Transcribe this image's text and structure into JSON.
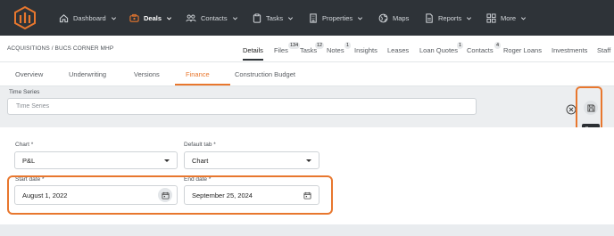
{
  "nav": {
    "items": [
      {
        "label": "Dashboard",
        "icon": "home-icon"
      },
      {
        "label": "Deals",
        "icon": "deals-icon",
        "active": true
      },
      {
        "label": "Contacts",
        "icon": "contacts-icon"
      },
      {
        "label": "Tasks",
        "icon": "clipboard-icon"
      },
      {
        "label": "Properties",
        "icon": "building-icon"
      },
      {
        "label": "Maps",
        "icon": "globe-icon"
      },
      {
        "label": "Reports",
        "icon": "document-icon"
      },
      {
        "label": "More",
        "icon": "grid-icon"
      }
    ]
  },
  "breadcrumb": "ACQUISITIONS / BUCS CORNER MHP",
  "record_tabs": [
    {
      "label": "Details",
      "active": true,
      "badge": ""
    },
    {
      "label": "Files",
      "badge": "134"
    },
    {
      "label": "Tasks",
      "badge": "12"
    },
    {
      "label": "Notes",
      "badge": "1"
    },
    {
      "label": "Insights",
      "badge": ""
    },
    {
      "label": "Leases",
      "badge": ""
    },
    {
      "label": "Loan Quotes",
      "badge": "1"
    },
    {
      "label": "Contacts",
      "badge": "4"
    },
    {
      "label": "Roger Loans",
      "badge": ""
    },
    {
      "label": "Investments",
      "badge": ""
    },
    {
      "label": "Staff",
      "badge": ""
    }
  ],
  "section_tabs": [
    {
      "label": "Overview"
    },
    {
      "label": "Underwriting"
    },
    {
      "label": "Versions"
    },
    {
      "label": "Finance",
      "active": true
    },
    {
      "label": "Construction Budget"
    }
  ],
  "time_series": {
    "label": "Time Series",
    "placeholder": "Time Series"
  },
  "save_tooltip": "Save",
  "form": {
    "chart_label": "Chart *",
    "chart_value": "P&L",
    "default_tab_label": "Default tab *",
    "default_tab_value": "Chart",
    "start_date_label": "Start date *",
    "start_date_value": "August 1, 2022",
    "end_date_label": "End date *",
    "end_date_value": "September 25, 2024"
  },
  "colors": {
    "accent": "#e8772e",
    "nav_bg": "#2e3338"
  }
}
